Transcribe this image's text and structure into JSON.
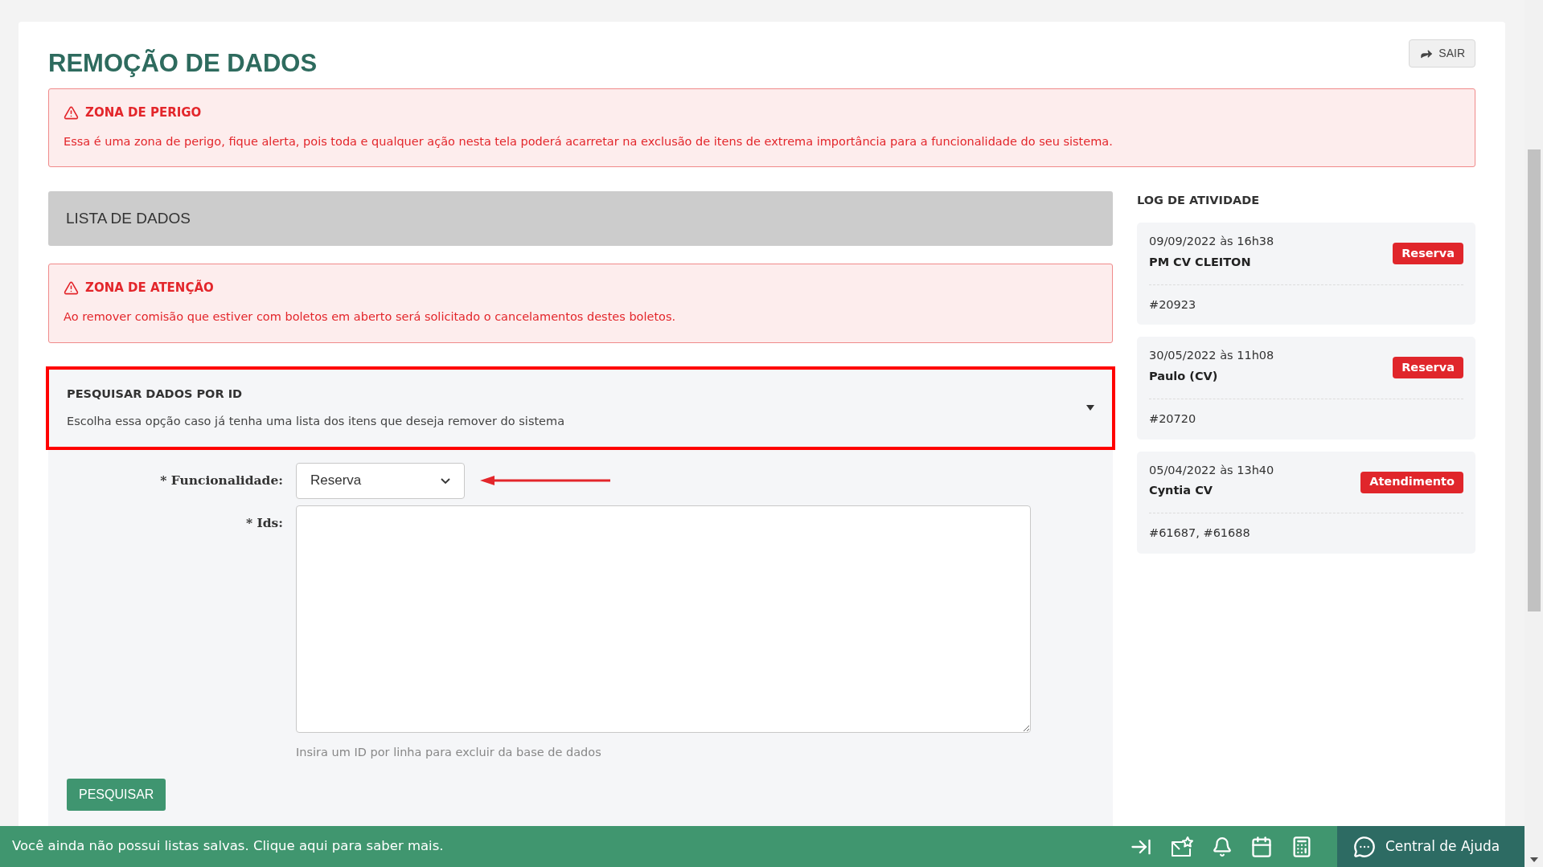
{
  "page": {
    "title": "REMOÇÃO DE DADOS",
    "exit_button": "SAIR"
  },
  "danger_alert": {
    "title": "ZONA DE PERIGO",
    "text": "Essa é uma zona de perigo, fique alerta, pois toda e qualquer ação nesta tela poderá acarretar na exclusão de itens de extrema importância para a funcionalidade do seu sistema."
  },
  "list_header": "LISTA DE DADOS",
  "attention_alert": {
    "title": "ZONA DE ATENÇÃO",
    "text": "Ao remover comisão que estiver com boletos em aberto será solicitado o cancelamentos destes boletos."
  },
  "search_panel": {
    "title": "PESQUISAR DADOS POR ID",
    "subtitle": "Escolha essa opção caso já tenha uma lista dos itens que deseja remover do sistema",
    "expanded": true
  },
  "form": {
    "functionality_label": "* Funcionalidade:",
    "functionality_value": "Reserva",
    "ids_label": "* Ids:",
    "ids_hint": "Insira um ID por linha para excluir da base de dados",
    "submit": "PESQUISAR"
  },
  "activity_log": {
    "title": "LOG DE ATIVIDADE",
    "entries": [
      {
        "date": "09/09/2022 às 16h38",
        "user": "PM CV CLEITON",
        "tag": "Reserva",
        "ids": "#20923"
      },
      {
        "date": "30/05/2022 às 11h08",
        "user": "Paulo (CV)",
        "tag": "Reserva",
        "ids": "#20720"
      },
      {
        "date": "05/04/2022 às 13h40",
        "user": "Cyntia CV",
        "tag": "Atendimento",
        "ids": "#61687, #61688"
      }
    ]
  },
  "bottom_bar": {
    "message": "Você ainda não possui listas salvas. Clique aqui para saber mais.",
    "help": "Central de Ajuda"
  }
}
